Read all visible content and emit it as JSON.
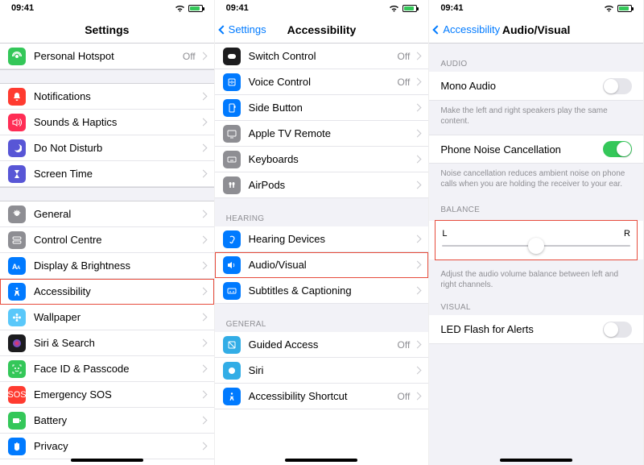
{
  "status": {
    "time": "09:41",
    "location_arrow": "↗",
    "wifi": "✓",
    "battery_pct": 80
  },
  "screen1": {
    "title": "Settings",
    "rows_top": [
      {
        "icon": "hotspot-icon",
        "bg": "bg-green",
        "label": "Personal Hotspot",
        "trailing": "Off"
      }
    ],
    "rows_mid": [
      {
        "icon": "bell-icon",
        "bg": "bg-red",
        "label": "Notifications"
      },
      {
        "icon": "speaker-icon",
        "bg": "bg-pink",
        "label": "Sounds & Haptics"
      },
      {
        "icon": "moon-icon",
        "bg": "bg-purple",
        "label": "Do Not Disturb"
      },
      {
        "icon": "hourglass-icon",
        "bg": "bg-indigo",
        "label": "Screen Time"
      }
    ],
    "rows_bot": [
      {
        "icon": "gear-icon",
        "bg": "bg-gray",
        "label": "General"
      },
      {
        "icon": "toggles-icon",
        "bg": "bg-gray",
        "label": "Control Centre"
      },
      {
        "icon": "textsize-icon",
        "bg": "bg-blue",
        "label": "Display & Brightness"
      },
      {
        "icon": "accessibility-icon",
        "bg": "bg-blue",
        "label": "Accessibility",
        "highlight": true
      },
      {
        "icon": "flower-icon",
        "bg": "bg-lightblue",
        "label": "Wallpaper"
      },
      {
        "icon": "siri-icon",
        "bg": "bg-black",
        "label": "Siri & Search"
      },
      {
        "icon": "faceid-icon",
        "bg": "bg-green",
        "label": "Face ID & Passcode"
      },
      {
        "icon": "sos-icon",
        "bg": "bg-red",
        "label": "Emergency SOS"
      },
      {
        "icon": "battery-icon",
        "bg": "bg-green",
        "label": "Battery"
      },
      {
        "icon": "hand-icon",
        "bg": "bg-blue",
        "label": "Privacy"
      }
    ]
  },
  "screen2": {
    "back": "Settings",
    "title": "Accessibility",
    "section_cont": [
      {
        "icon": "switch-icon",
        "bg": "bg-black",
        "label": "Switch Control",
        "trailing": "Off"
      },
      {
        "icon": "voice-icon",
        "bg": "bg-blue",
        "label": "Voice Control",
        "trailing": "Off"
      },
      {
        "icon": "sidebutton-icon",
        "bg": "bg-blue",
        "label": "Side Button"
      },
      {
        "icon": "tv-icon",
        "bg": "bg-gray",
        "label": "Apple TV Remote"
      },
      {
        "icon": "keyboard-icon",
        "bg": "bg-gray",
        "label": "Keyboards"
      },
      {
        "icon": "airpods-icon",
        "bg": "bg-gray",
        "label": "AirPods"
      }
    ],
    "hearing_header": "HEARING",
    "section_hearing": [
      {
        "icon": "ear-icon",
        "bg": "bg-blue",
        "label": "Hearing Devices"
      },
      {
        "icon": "audio-icon",
        "bg": "bg-blue",
        "label": "Audio/Visual",
        "highlight": true
      },
      {
        "icon": "caption-icon",
        "bg": "bg-blue",
        "label": "Subtitles & Captioning"
      }
    ],
    "general_header": "GENERAL",
    "section_general": [
      {
        "icon": "guided-icon",
        "bg": "bg-teal",
        "label": "Guided Access",
        "trailing": "Off"
      },
      {
        "icon": "siri2-icon",
        "bg": "bg-teal",
        "label": "Siri"
      },
      {
        "icon": "shortcut-icon",
        "bg": "bg-blue",
        "label": "Accessibility Shortcut",
        "trailing": "Off"
      }
    ]
  },
  "screen3": {
    "back": "Accessibility",
    "title": "Audio/Visual",
    "audio_header": "AUDIO",
    "mono_label": "Mono Audio",
    "mono_on": false,
    "mono_foot": "Make the left and right speakers play the same content.",
    "noise_label": "Phone Noise Cancellation",
    "noise_on": true,
    "noise_foot": "Noise cancellation reduces ambient noise on phone calls when you are holding the receiver to your ear.",
    "balance_header": "BALANCE",
    "balance_left": "L",
    "balance_right": "R",
    "balance_value": 0.5,
    "balance_foot": "Adjust the audio volume balance between left and right channels.",
    "visual_header": "VISUAL",
    "led_label": "LED Flash for Alerts",
    "led_on": false
  }
}
